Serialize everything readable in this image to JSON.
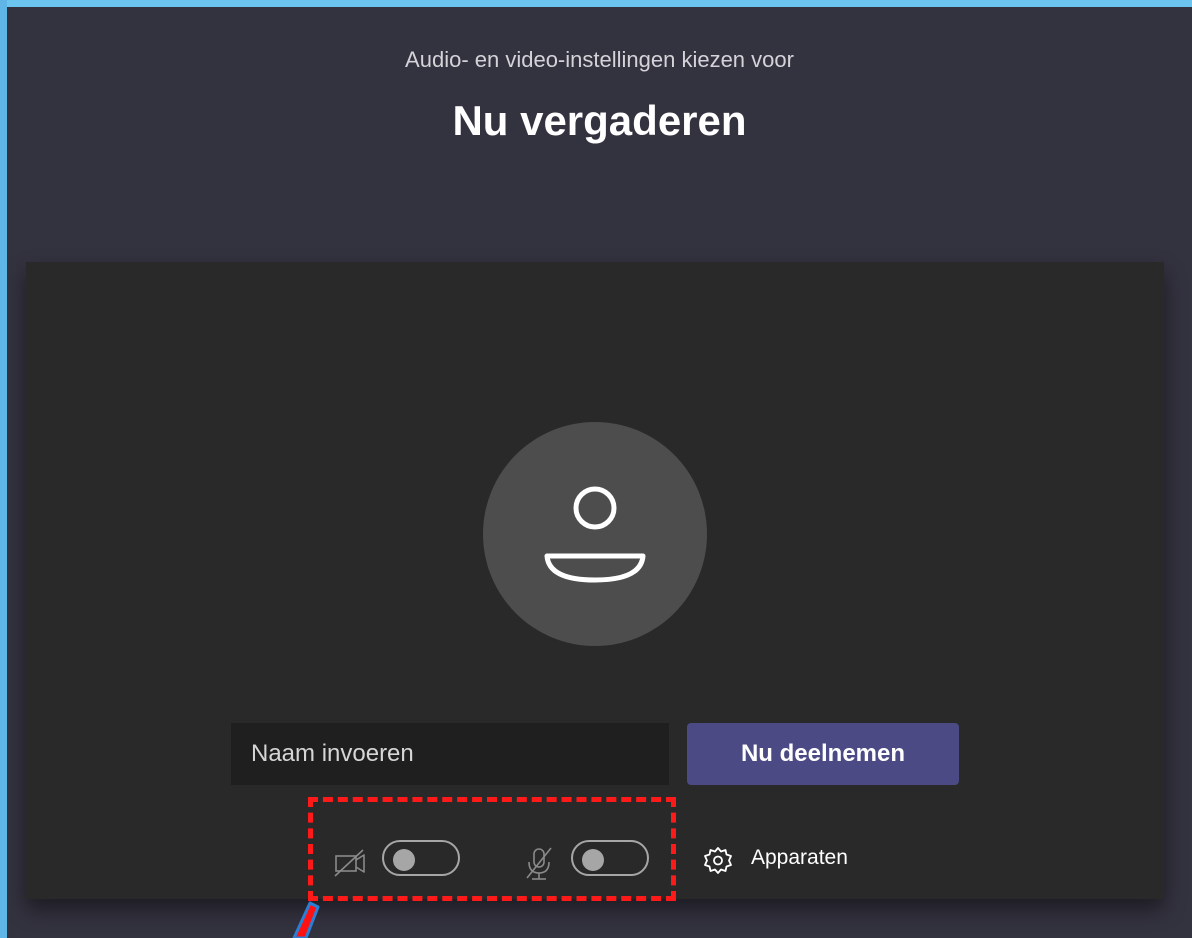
{
  "header": {
    "subtitle": "Audio- en video-instellingen kiezen voor",
    "title": "Nu vergaderen"
  },
  "preview": {
    "avatar_icon": "person-icon"
  },
  "join": {
    "name_placeholder": "Naam invoeren",
    "name_value": "",
    "join_label": "Nu deelnemen"
  },
  "controls": {
    "camera_icon": "camera-off-icon",
    "camera_on": false,
    "mic_icon": "mic-off-icon",
    "mic_on": false,
    "devices_icon": "gear-icon",
    "devices_label": "Apparaten"
  },
  "colors": {
    "background": "#33323f",
    "preview": "#292929",
    "accent": "#4b4a84",
    "highlight": "#ff1a1a"
  }
}
